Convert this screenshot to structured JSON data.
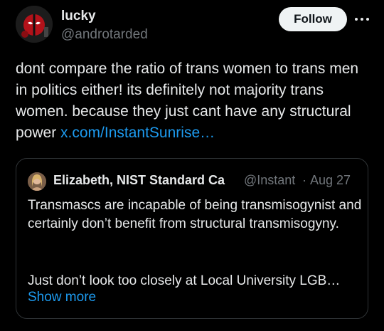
{
  "author": {
    "name": "lucky",
    "handle": "@androtarded",
    "avatar_icon": "deadpool-avatar"
  },
  "actions": {
    "follow_label": "Follow",
    "more_icon": "more-horizontal-icon"
  },
  "tweet": {
    "text": "dont compare the ratio of trans women to trans men in politics either! its definitely not majority trans women. because they just cant have any structural power ",
    "link": "x.com/InstantSunrise…"
  },
  "quote": {
    "name": "Elizabeth, NIST Standard Ca",
    "handle": "@Instant",
    "separator": "·",
    "date": "Aug 27",
    "text": "Transmascs are incapable of being transmisogynist and certainly don’t benefit from structural transmisogyny.",
    "text2": "Just don’t look too closely at Local University LGB…",
    "show_more": "Show more"
  },
  "colors": {
    "background": "#000000",
    "text": "#e7e9ea",
    "muted": "#71767b",
    "link": "#1d9bf0",
    "border": "#2f3336"
  }
}
